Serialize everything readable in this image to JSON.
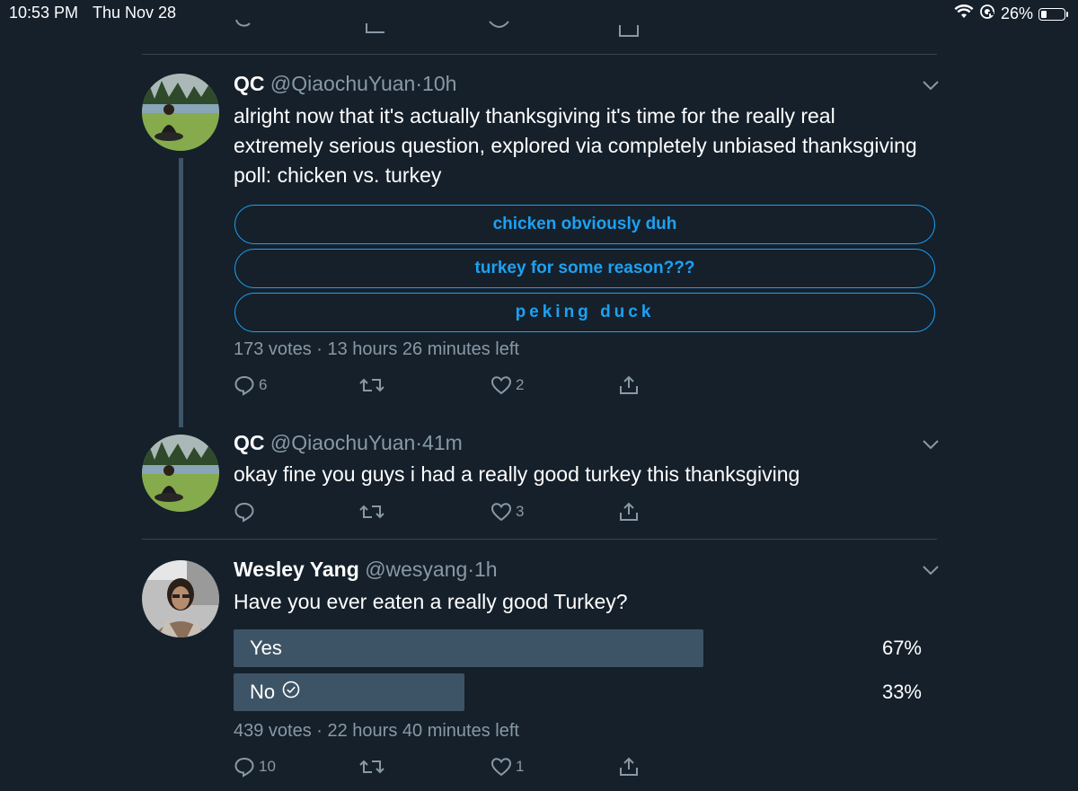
{
  "status_bar": {
    "time": "10:53 PM",
    "date": "Thu Nov 28",
    "battery": "26%",
    "battery_level": 0.26,
    "icons": [
      "wifi-icon",
      "location-lock-icon",
      "battery-icon"
    ]
  },
  "colors": {
    "background": "#15202b",
    "accent": "#1da1f2",
    "muted": "#8899a6",
    "divider": "#38444d",
    "poll_bar": "#3d5466"
  },
  "tweets": [
    {
      "name": "QC",
      "handle": "@QiaochuYuan",
      "dot": "·",
      "time": "10h",
      "text": "alright now that it's actually thanksgiving it's time for the really real extremely serious question, explored via completely unbiased thanksgiving poll: chicken vs. turkey",
      "poll_options": [
        "chicken obviously duh",
        "turkey for some reason???",
        "peking duck"
      ],
      "poll_meta": "173 votes · 13 hours 26 minutes left",
      "replies": "6",
      "retweets": "",
      "likes": "2"
    },
    {
      "name": "QC",
      "handle": "@QiaochuYuan",
      "dot": "·",
      "time": "41m",
      "text": "okay fine you guys i had a really good turkey this thanksgiving",
      "replies": "",
      "retweets": "",
      "likes": "3"
    },
    {
      "name": "Wesley Yang",
      "handle": "@wesyang",
      "dot": "·",
      "time": "1h",
      "text": "Have you ever eaten a really good Turkey?",
      "poll_results": [
        {
          "label": "Yes",
          "percent": "67%",
          "share": 0.67,
          "voted": false
        },
        {
          "label": "No",
          "percent": "33%",
          "share": 0.33,
          "voted": true
        }
      ],
      "poll_meta": "439 votes · 22 hours 40 minutes left",
      "replies": "10",
      "retweets": "",
      "likes": "1"
    }
  ]
}
